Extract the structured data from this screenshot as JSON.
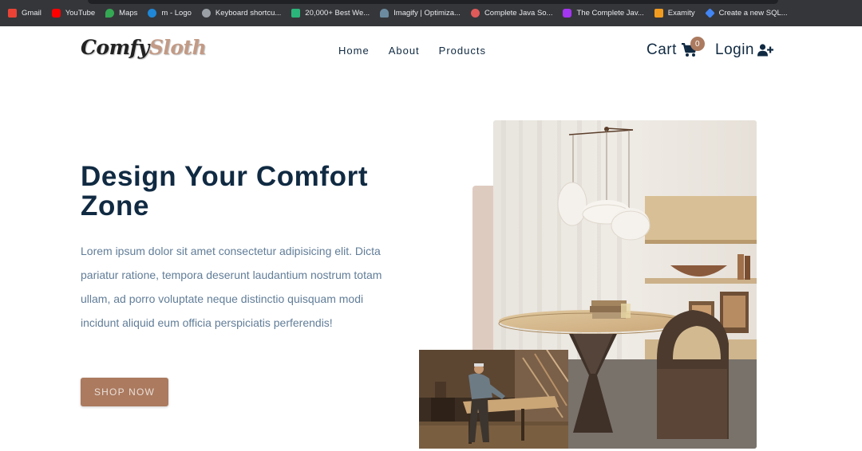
{
  "bookmarks": [
    {
      "label": "Gmail",
      "icon": "gmail-icon",
      "color": "#ea4335"
    },
    {
      "label": "YouTube",
      "icon": "youtube-icon",
      "color": "#ff0000"
    },
    {
      "label": "Maps",
      "icon": "maps-icon",
      "color": "#34a853"
    },
    {
      "label": "m - Logo",
      "icon": "edge-icon",
      "color": "#1f87d6"
    },
    {
      "label": "Keyboard shortcu...",
      "icon": "apple-icon",
      "color": "#9aa0a6"
    },
    {
      "label": "20,000+ Best We...",
      "icon": "site-icon",
      "color": "#2bb57a"
    },
    {
      "label": "Imagify | Optimiza...",
      "icon": "imagify-icon",
      "color": "#6c8ba0"
    },
    {
      "label": "Complete Java So...",
      "icon": "java-icon",
      "color": "#e05a5a"
    },
    {
      "label": "The Complete Jav...",
      "icon": "udemy-icon",
      "color": "#a435f0"
    },
    {
      "label": "Examity",
      "icon": "examity-icon",
      "color": "#f29c1f"
    },
    {
      "label": "Create a new SQL...",
      "icon": "sql-icon",
      "color": "#4285f4"
    }
  ],
  "navbar": {
    "logo_part1": "Comfy",
    "logo_part2": "Sloth",
    "links": [
      "Home",
      "About",
      "Products"
    ],
    "cart_label": "Cart",
    "cart_count": "0",
    "login_label": "Login"
  },
  "hero": {
    "title": "Design Your Comfort Zone",
    "text": "Lorem ipsum dolor sit amet consectetur adipisicing elit. Dicta pariatur ratione, tempora deserunt laudantium nostrum totam ullam, ad porro voluptate neque distinctio quisquam modi incidunt aliquid eum officia perspiciatis perferendis!",
    "button_label": "SHOP NOW"
  },
  "colors": {
    "primary": "#ab7a5f",
    "title": "#102a42",
    "text": "#617d98",
    "accent_bar": "#decbc0"
  }
}
